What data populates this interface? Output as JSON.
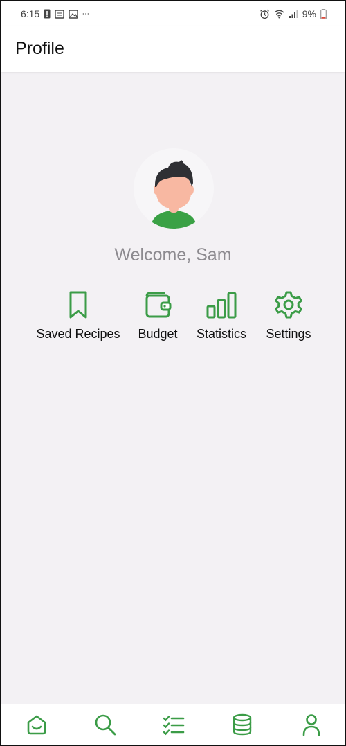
{
  "status_bar": {
    "time": "6:15",
    "battery": "9%",
    "left_icons": [
      "alert-icon",
      "screen-icon",
      "image-icon",
      "more-dots-icon"
    ],
    "right_icons": [
      "alarm-icon",
      "wifi-icon",
      "signal-icon",
      "battery-icon"
    ]
  },
  "header": {
    "title": "Profile"
  },
  "profile": {
    "welcome": "Welcome, Sam",
    "avatar_icon": "avatar-icon"
  },
  "actions": [
    {
      "label": "Saved Recipes",
      "icon": "bookmark-icon"
    },
    {
      "label": "Budget",
      "icon": "wallet-icon"
    },
    {
      "label": "Statistics",
      "icon": "bar-chart-icon"
    },
    {
      "label": "Settings",
      "icon": "gear-icon"
    }
  ],
  "bottom_nav": [
    {
      "icon": "home-icon"
    },
    {
      "icon": "search-icon"
    },
    {
      "icon": "checklist-icon"
    },
    {
      "icon": "database-icon"
    },
    {
      "icon": "user-icon"
    }
  ],
  "colors": {
    "accent": "#3b9c47",
    "background": "#f3f1f4",
    "welcome_text": "#8c8a8f",
    "avatar_shirt": "#3aa145",
    "avatar_skin": "#f8b8a2",
    "avatar_hair": "#2f3034"
  }
}
